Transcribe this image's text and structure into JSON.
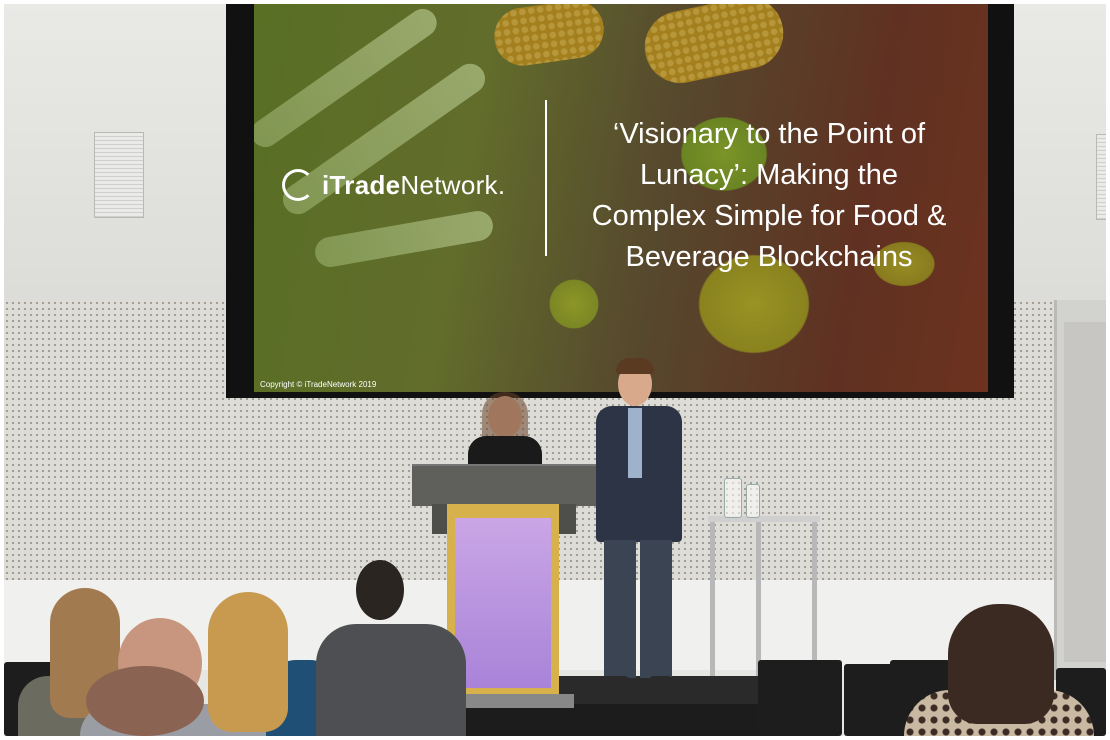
{
  "slide": {
    "logo_text_bold": "iTrade",
    "logo_text_rest": "Network.",
    "title_lines": [
      "‘Visionary to the Point of",
      "Lunacy’: Making the",
      "Complex Simple for Food &",
      "Beverage Blockchains"
    ],
    "copyright": "Copyright © iTradeNetwork 2019"
  },
  "colors": {
    "screen_frame": "#111111",
    "podium_frame": "#d7b24c",
    "podium_panel": "#b38ddc",
    "wall": "#dedcd6"
  }
}
